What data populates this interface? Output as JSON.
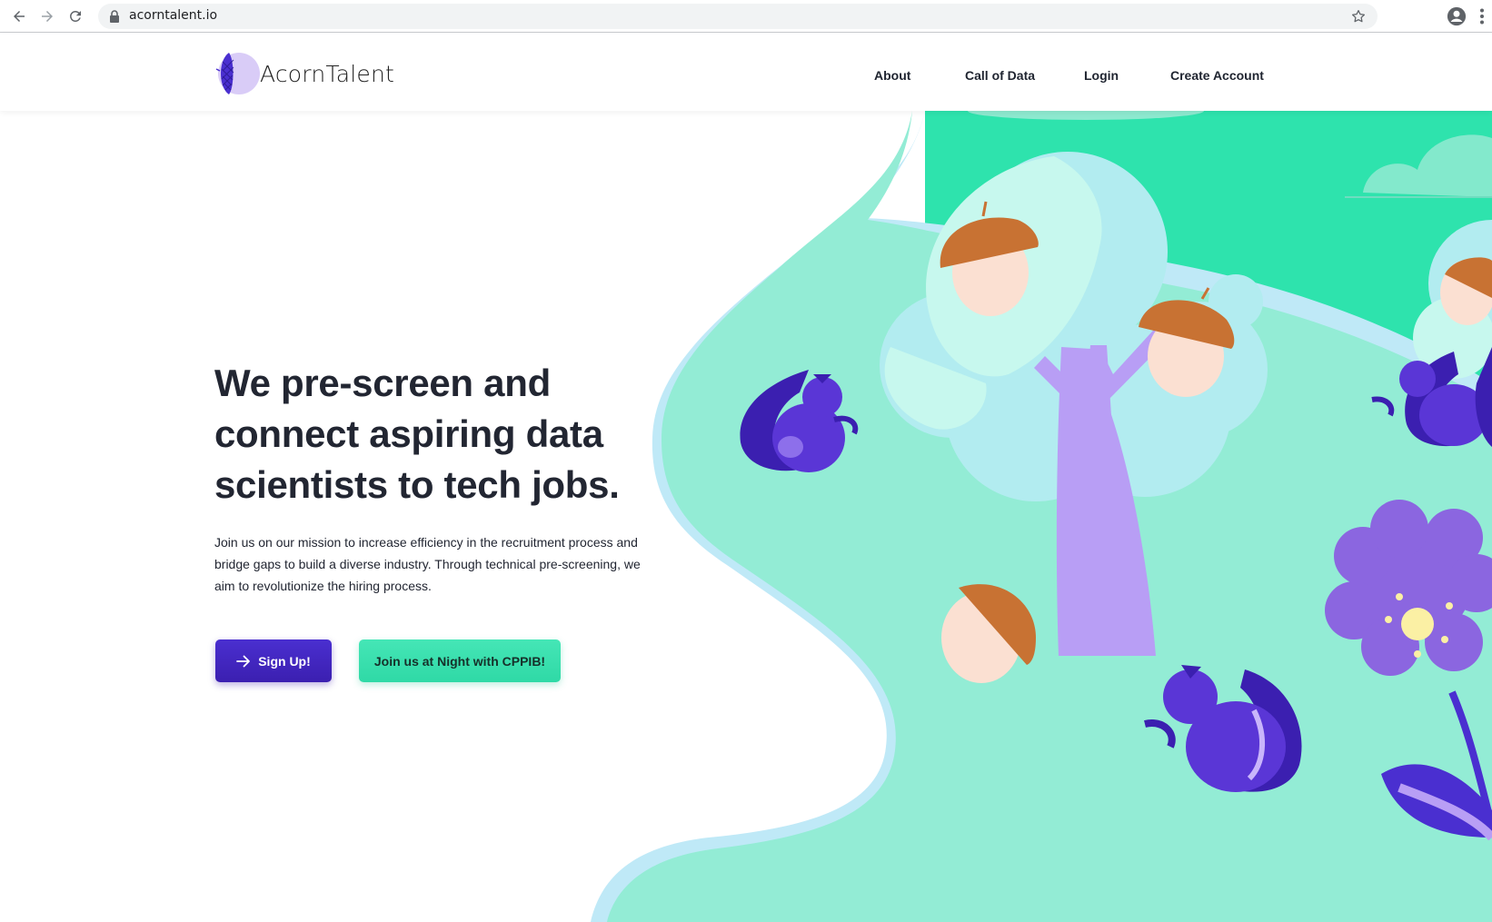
{
  "browser": {
    "url": "acorntalent.io"
  },
  "site": {
    "logo_text": "AcornTalent",
    "nav": [
      {
        "label": "About"
      },
      {
        "label": "Call of Data"
      },
      {
        "label": "Login"
      },
      {
        "label": "Create Account"
      }
    ]
  },
  "hero": {
    "headline": "We pre-screen and connect aspiring data scientists to tech jobs.",
    "subtext": "Join us on our mission to increase efficiency in the recruitment process and bridge gaps to build a diverse industry. Through technical pre-screening, we aim to revolutionize the hiring process.",
    "primary_button": "Sign Up!",
    "secondary_button": "Join us at Night with CPPIB!"
  },
  "colors": {
    "brand_purple": "#4a2fd0",
    "brand_mint": "#2fe3ad",
    "illustration_ground": "#93ecd5",
    "tree_trunk": "#b89ef5"
  },
  "icons": {
    "back": "arrow-left-icon",
    "forward": "arrow-right-icon",
    "reload": "reload-icon",
    "secure": "lock-icon",
    "bookmark": "star-icon",
    "profile": "account-circle-icon",
    "menu": "kebab-menu-icon",
    "sign_up": "arrow-right-icon"
  }
}
